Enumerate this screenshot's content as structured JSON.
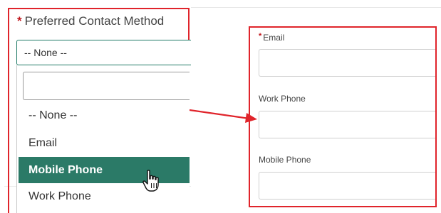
{
  "contact_method": {
    "label": "Preferred Contact Method",
    "required_mark": "*",
    "selected_value": "-- None --",
    "search_value": "",
    "options": [
      "-- None --",
      "Email",
      "Mobile Phone",
      "Work Phone"
    ],
    "highlighted_option": "Mobile Phone"
  },
  "right_panel": {
    "email": {
      "label": "Email",
      "required_mark": "*",
      "value": ""
    },
    "work_phone": {
      "label": "Work Phone",
      "value": ""
    },
    "mobile_phone": {
      "label": "Mobile Phone",
      "value": ""
    }
  },
  "colors": {
    "highlight_frame": "#e0242b",
    "selected_option_bg": "#2b7a67",
    "select_border": "#1f7a66"
  },
  "icons": [
    "hand-pointer-cursor-icon",
    "arrow-right-icon"
  ]
}
